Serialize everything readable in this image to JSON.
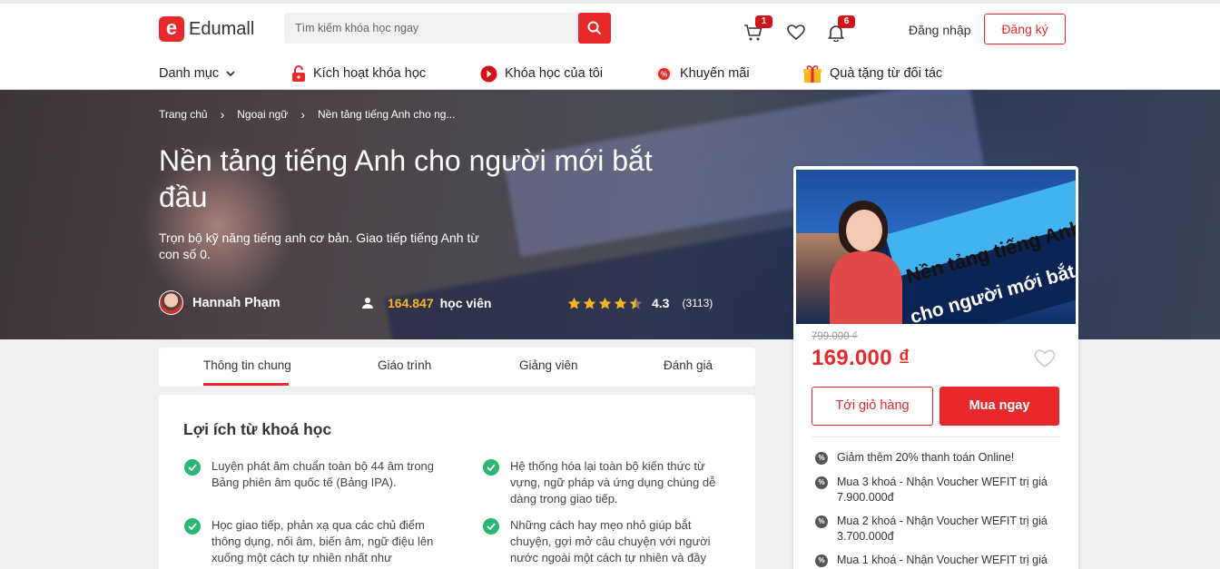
{
  "header": {
    "logo_letter": "e",
    "logo_text": "Edumall",
    "search": {
      "placeholder": "Tìm kiếm khóa học ngay"
    },
    "cart_count": "1",
    "notification_count": "6",
    "login_label": "Đăng nhập",
    "register_label": "Đăng ký",
    "nav": [
      {
        "label": "Danh mục",
        "icon": "chevron-down-icon"
      },
      {
        "label": "Kích hoạt khóa học",
        "icon": "lock-icon"
      },
      {
        "label": "Khóa học của tôi",
        "icon": "play-icon"
      },
      {
        "label": "Khuyến mãi",
        "icon": "discount-icon"
      },
      {
        "label": "Quà tặng từ đối tác",
        "icon": "gift-icon"
      }
    ]
  },
  "hero": {
    "breadcrumb": [
      "Trang chủ",
      "Ngoại ngữ",
      "Nền tảng tiếng Anh cho ng..."
    ],
    "title": "Nền tảng tiếng Anh cho người mới bắt đầu",
    "subtitle": "Trọn bộ kỹ năng tiếng anh cơ bản. Giao tiếp tiếng Anh từ con số 0.",
    "author": "Hannah Phạm",
    "students_count": "164.847",
    "students_label": "học viên",
    "rating_value": 4.3,
    "rating_text": "4.3",
    "reviews": "(3113)"
  },
  "tabs": [
    "Thông tin chung",
    "Giáo trình",
    "Giảng viên",
    "Đánh giá"
  ],
  "benefits": {
    "heading": "Lợi ích từ khoá học",
    "items": [
      "Luyện phát âm chuẩn toàn bộ 44 âm trong Bảng phiên âm quốc tế (Bảng IPA).",
      "Hệ thống hóa lại toàn bộ kiến thức từ vựng, ngữ pháp và ứng dụng chúng dễ dàng trong giao tiếp.",
      "Học giao tiếp, phản xạ qua các chủ điểm thông dụng, nối âm, biến âm, ngữ điệu lên xuống một cách tự nhiên nhất như",
      "Những cách hay mẹo nhỏ giúp bắt chuyện, gợi mở câu chuyện với người nước ngoài một cách tự nhiên và đầy"
    ]
  },
  "card": {
    "thumb_text_1": "Nền tảng tiếng Anh",
    "thumb_text_2": "cho người mới bắt đầu",
    "old_price": "799.000 ₫",
    "price": "169.000 ₫",
    "add_to_cart": "Tới giỏ hàng",
    "buy_now": "Mua ngay",
    "promos": [
      "Giảm thêm 20% thanh toán Online!",
      "Mua 3 khoá - Nhận Voucher WEFIT trị giá 7.900.000đ",
      "Mua 2 khoá - Nhận Voucher WEFIT trị giá 3.700.000đ",
      "Mua 1 khoá - Nhận Voucher WEFIT trị giá"
    ]
  },
  "colors": {
    "brand": "#e7292b",
    "success": "#2bb673",
    "star": "#f6b520"
  }
}
